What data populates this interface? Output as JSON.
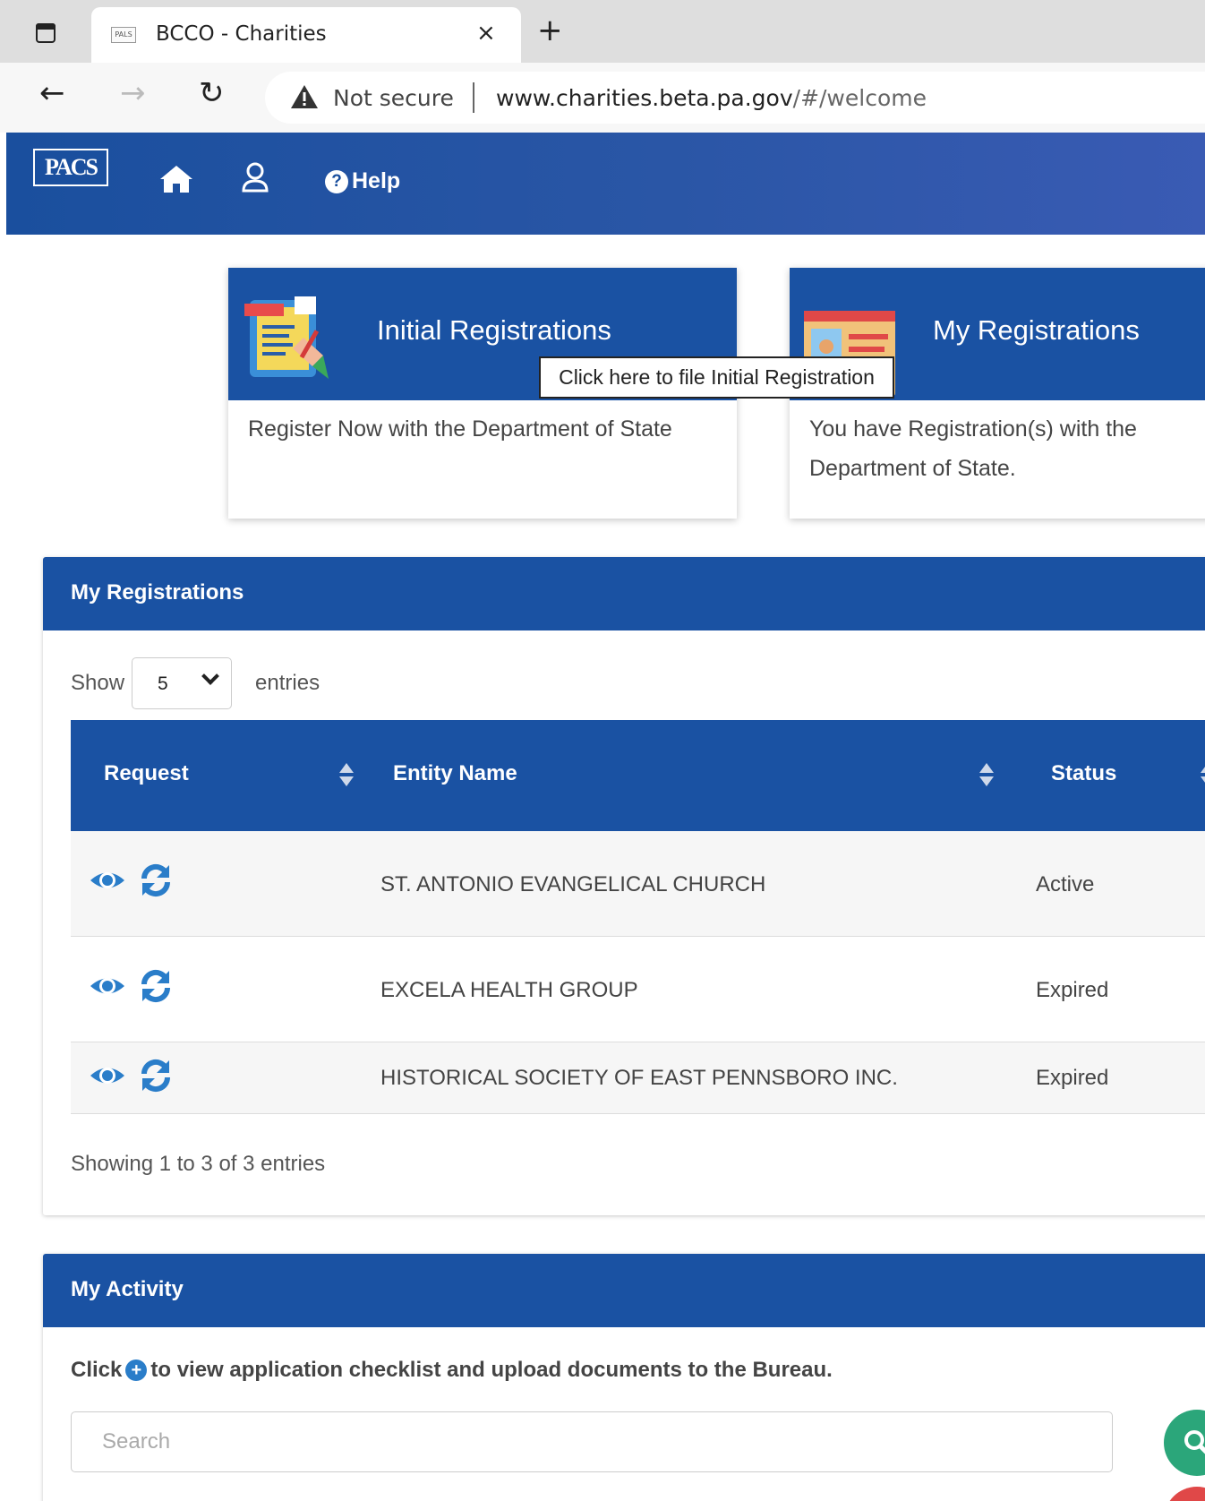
{
  "browser": {
    "tab_title": "BCCO - Charities",
    "favicon_text": "PALS",
    "new_tab_label": "+",
    "close_label": "×",
    "security_label": "Not secure",
    "url_host": "www.charities.beta.pa.gov",
    "url_path": "/#/welcome"
  },
  "nav": {
    "logo_text": "PACS",
    "help_label": "Help",
    "icons": [
      "home-icon",
      "user-icon",
      "question-circle-icon"
    ]
  },
  "cards": [
    {
      "title": "Initial Registrations",
      "body": "Register Now with the Department of State"
    },
    {
      "title": "My Registrations",
      "body_line1": "You have Registration(s) with the",
      "body_line2": "Department of State."
    }
  ],
  "tooltip": "Click here to file Initial Registration",
  "registrations_panel": {
    "title": "My Registrations",
    "show_label": "Show",
    "entries_value": "5",
    "entries_label": "entries",
    "columns": [
      "Request",
      "Entity Name",
      "Status"
    ],
    "rows": [
      {
        "entity": "ST. ANTONIO EVANGELICAL CHURCH",
        "status": "Active"
      },
      {
        "entity": "EXCELA HEALTH GROUP",
        "status": "Expired"
      },
      {
        "entity": "HISTORICAL SOCIETY OF EAST PENNSBORO INC.",
        "status": "Expired"
      }
    ],
    "info": "Showing 1 to 3 of 3 entries"
  },
  "activity_panel": {
    "title": "My Activity",
    "instruction_pre": "Click",
    "instruction_post": "to view application checklist and upload documents to the Bureau.",
    "search_placeholder": "Search"
  },
  "colors": {
    "primary": "#1a52a3",
    "search_button": "#2ba67a",
    "icon_blue": "#2a7dc9"
  }
}
